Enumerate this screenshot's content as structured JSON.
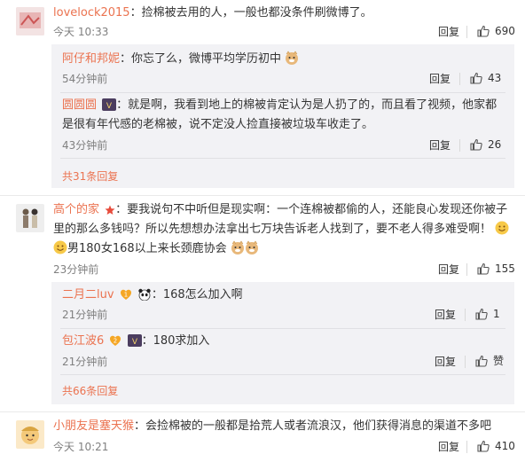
{
  "comments": [
    {
      "user": "lovelock2015",
      "text": "：捡棉被去用的人，一般也都没条件刷微博了。",
      "time": "今天 10:33",
      "reply_label": "回复",
      "likes": "690",
      "replies": [
        {
          "user": "阿仔和邦妮",
          "text": "：你忘了么，微博平均学历初中",
          "time": "54分钟前",
          "reply_label": "回复",
          "likes": "43"
        },
        {
          "user": "圆圆圆",
          "text": "：就是啊，我看到地上的棉被肯定认为是人扔了的，而且看了视频，他家都是很有年代感的老棉被，说不定没人捡直接被垃圾车收走了。",
          "time": "43分钟前",
          "reply_label": "回复",
          "likes": "26"
        }
      ],
      "more_label": "共31条回复"
    },
    {
      "user": "高个的家",
      "text": "：要我说句不中听但是现实啊：一个连棉被都偷的人，还能良心发现还你被子里的那么多钱吗？所以先想想办法拿出七万块告诉老人找到了，要不老人得多难受啊！",
      "text_tail": "男180女168以上来长颈鹿协会",
      "time": "23分钟前",
      "reply_label": "回复",
      "likes": "155",
      "replies": [
        {
          "user": "二月二luv",
          "text": "：168怎么加入啊",
          "time": "21分钟前",
          "reply_label": "回复",
          "likes": "1"
        },
        {
          "user": "包江波6",
          "text": "：180求加入",
          "time": "21分钟前",
          "reply_label": "回复",
          "likes": "赞"
        }
      ],
      "more_label": "共66条回复"
    },
    {
      "user": "小朋友是塞天猴",
      "text": "：会捡棉被的一般都是拾荒人或者流浪汉，他们获得消息的渠道不多吧",
      "time": "今天 10:21",
      "reply_label": "回复",
      "likes": "410"
    }
  ],
  "icons": {
    "like": "thumbs-up-icon",
    "emoji_smile": "smile-emoji-icon",
    "emoji_doge": "doge-emoji-icon",
    "badge_vip": "vip-badge-icon",
    "badge_star": "star-badge-icon",
    "badge_panda": "panda-badge-icon"
  },
  "colors": {
    "username": "#eb7350",
    "subpanel": "#f2f2f5",
    "meta": "#808080"
  }
}
